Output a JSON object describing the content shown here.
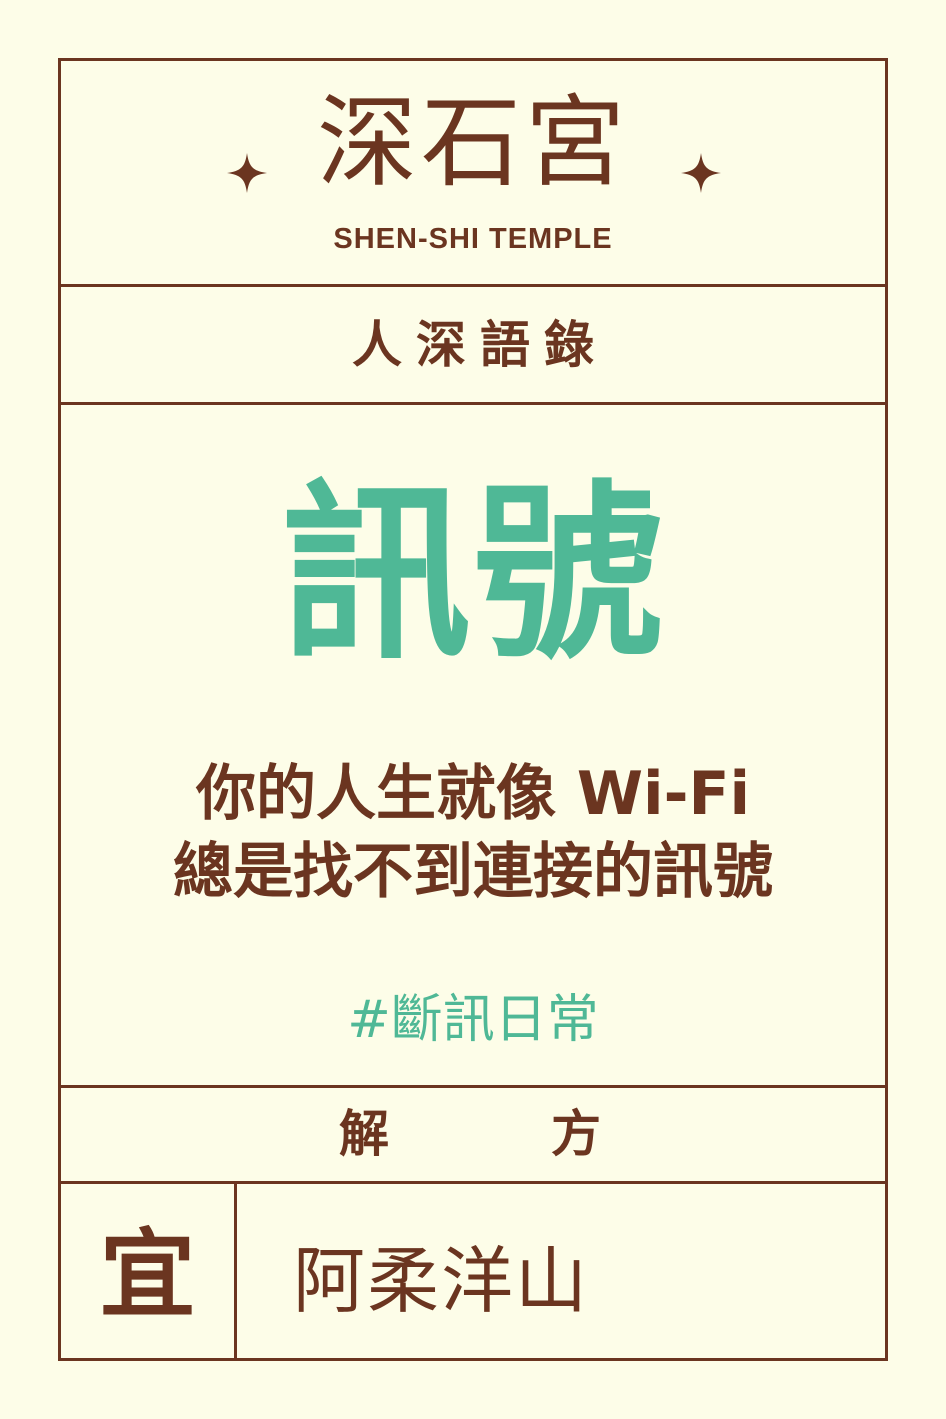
{
  "header": {
    "temple_name": "深石宮",
    "temple_name_en": "SHEN-SHI TEMPLE"
  },
  "section_title": "人深語錄",
  "main": {
    "title": "訊號",
    "quote_lines": [
      "你的人生就像 Wi-Fi",
      "總是找不到連接的訊號"
    ],
    "hashtag": "#斷訊日常"
  },
  "remedy": {
    "label_parts": [
      "解",
      "方"
    ],
    "yi_label": "宜",
    "value": "阿柔洋山"
  },
  "icons": {
    "decoration": "sparkle-icon"
  },
  "colors": {
    "background": "#fdfde8",
    "brown": "#6b3520",
    "green": "#4fb896"
  }
}
